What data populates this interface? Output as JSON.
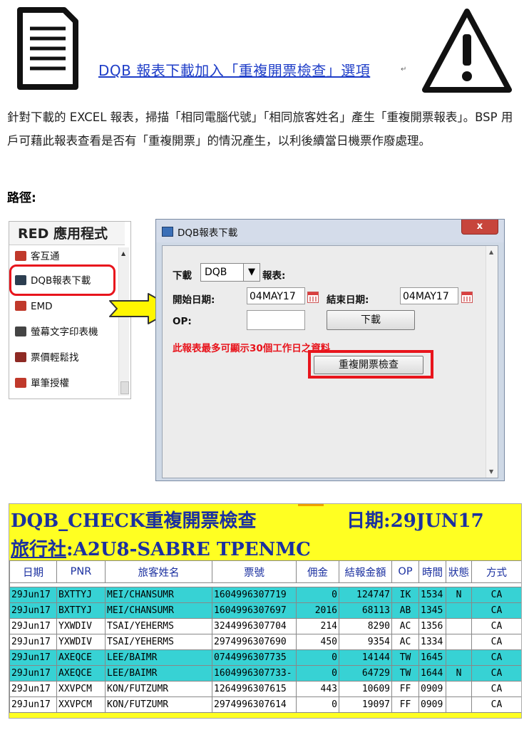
{
  "header": {
    "title": "DQB 報表下載加入「重複開票檢查」選項",
    "title_mark": "↵"
  },
  "description": "針對下載的 EXCEL 報表，掃描「相同電腦代號」「相同旅客姓名」產生「重複開票報表」。BSP 用戶可藉此報表查看是否有「重複開票」的情況產生，以利後續當日機票作廢處理。",
  "path_label": "路徑:",
  "red_panel": {
    "title": "RED 應用程式",
    "items": [
      {
        "label": "客互通",
        "icon": "person-card-icon",
        "color": "#c0392b"
      },
      {
        "label": "DQB報表下載",
        "icon": "bar-chart-icon",
        "color": "#2c3e50"
      },
      {
        "label": "EMD",
        "icon": "emd-icon",
        "color": "#c0392b"
      },
      {
        "label": "螢幕文字印表機",
        "icon": "printer-icon",
        "color": "#444444"
      },
      {
        "label": "票價輕鬆找",
        "icon": "search-ticket-icon",
        "color": "#8e2a24"
      },
      {
        "label": "單筆授權",
        "icon": "authorize-icon",
        "color": "#c0392b"
      }
    ]
  },
  "dialog": {
    "title": "DQB報表下載",
    "close_label": "x",
    "download_label": "下載",
    "report_type": "DQB",
    "report_suffix": "報表:",
    "start_label": "開始日期:",
    "start_value": "04MAY17",
    "end_label": "結束日期:",
    "end_value": "04MAY17",
    "op_label": "OP:",
    "op_value": "",
    "download_button": "下載",
    "warning": "此報表最多可顯示30個工作日之資料",
    "check_button": "重複開票檢查"
  },
  "sheet": {
    "title": "DQB_CHECK重複開票檢查",
    "date_label": "日期:29JUN17",
    "agency_prefix": "旅行社",
    "agency_value": ":A2U8-SABRE TPENMC",
    "columns": [
      "日期",
      "PNR",
      "旅客姓名",
      "票號",
      "佣金",
      "結報金額",
      "OP",
      "時間",
      "狀態",
      "方式"
    ],
    "rows": [
      {
        "hl": true,
        "cells": [
          "29Jun17",
          "BXTTYJ",
          "MEI/CHANSUMR",
          "1604996307719",
          "0",
          "124747",
          "IK",
          "1534",
          "N",
          "CA"
        ]
      },
      {
        "hl": true,
        "cells": [
          "29Jun17",
          "BXTTYJ",
          "MEI/CHANSUMR",
          "1604996307697",
          "2016",
          "68113",
          "AB",
          "1345",
          "",
          "CA"
        ]
      },
      {
        "hl": false,
        "cells": [
          "29Jun17",
          "YXWDIV",
          "TSAI/YEHERMS",
          "3244996307704",
          "214",
          "8290",
          "AC",
          "1356",
          "",
          "CA"
        ]
      },
      {
        "hl": false,
        "cells": [
          "29Jun17",
          "YXWDIV",
          "TSAI/YEHERMS",
          "2974996307690",
          "450",
          "9354",
          "AC",
          "1334",
          "",
          "CA"
        ]
      },
      {
        "hl": true,
        "cells": [
          "29Jun17",
          "AXEQCE",
          "LEE/BAIMR",
          "0744996307735",
          "0",
          "14144",
          "TW",
          "1645",
          "",
          "CA"
        ]
      },
      {
        "hl": true,
        "cells": [
          "29Jun17",
          "AXEQCE",
          "LEE/BAIMR",
          "1604996307733-",
          "0",
          "64729",
          "TW",
          "1644",
          "N",
          "CA"
        ]
      },
      {
        "hl": false,
        "cells": [
          "29Jun17",
          "XXVPCM",
          "KON/FUTZUMR",
          "1264996307615",
          "443",
          "10609",
          "FF",
          "0909",
          "",
          "CA"
        ]
      },
      {
        "hl": false,
        "cells": [
          "29Jun17",
          "XXVPCM",
          "KON/FUTZUMR",
          "2974996307614",
          "0",
          "19097",
          "FF",
          "0909",
          "",
          "CA"
        ]
      }
    ]
  }
}
